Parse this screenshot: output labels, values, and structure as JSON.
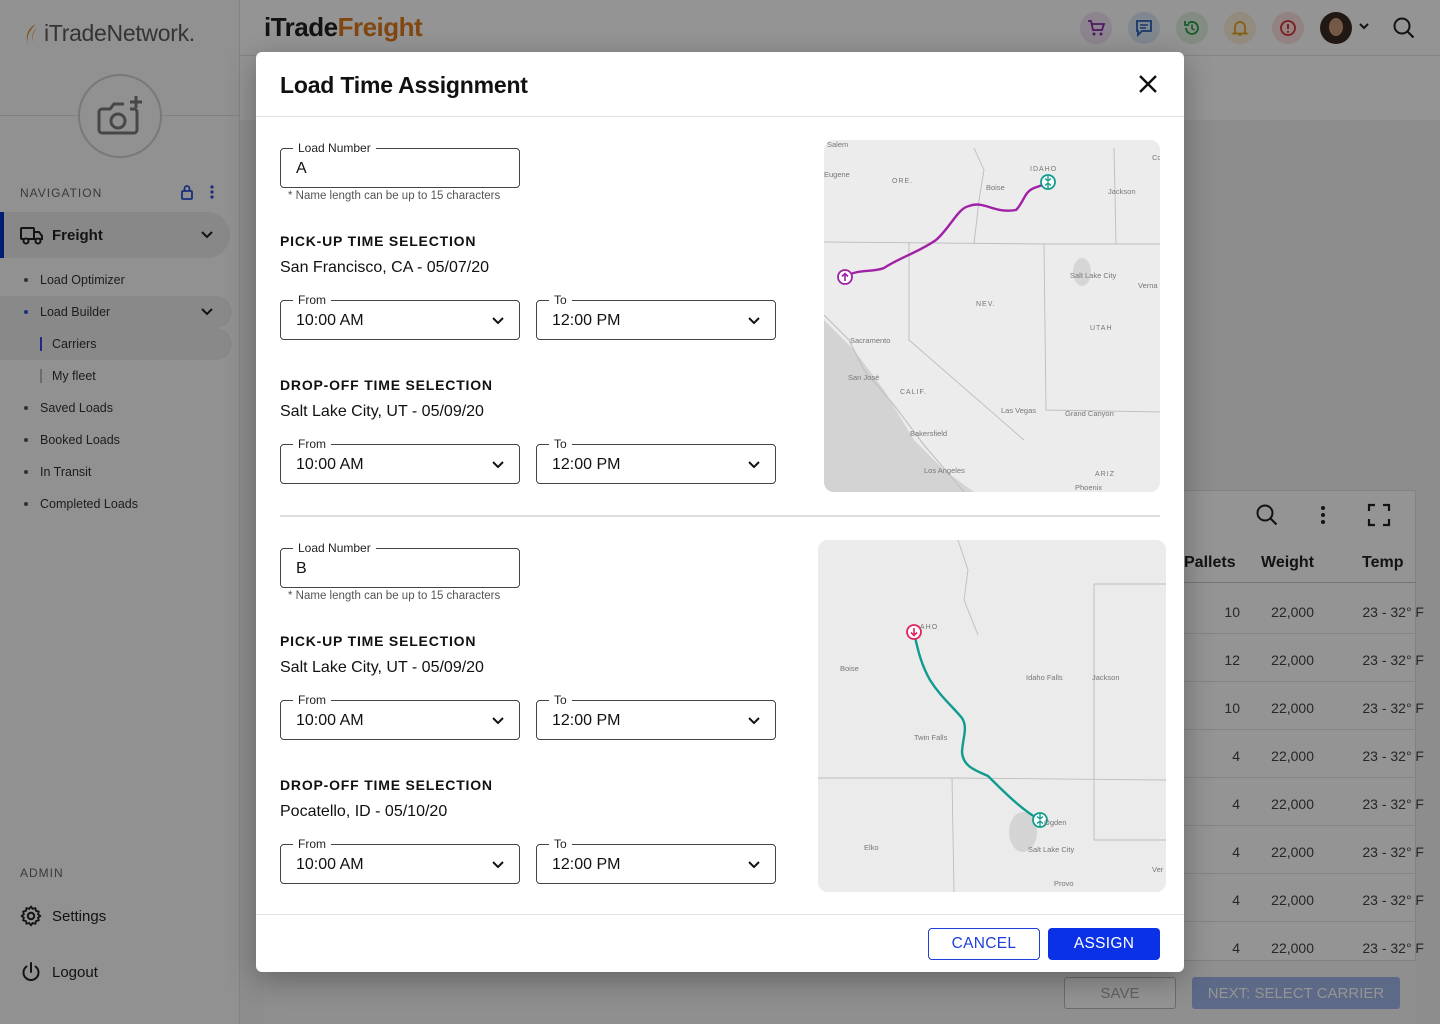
{
  "sidebar": {
    "brand": "iTradeNetwork.",
    "navigation_title": "NAVIGATION",
    "freight_label": "Freight",
    "items": [
      {
        "label": "Load Optimizer"
      },
      {
        "label": "Load Builder"
      },
      {
        "label": "Carriers"
      },
      {
        "label": "My fleet"
      },
      {
        "label": "Saved Loads"
      },
      {
        "label": "Booked Loads"
      },
      {
        "label": "In Transit"
      },
      {
        "label": "Completed Loads"
      }
    ],
    "admin_title": "ADMIN",
    "settings_label": "Settings",
    "logout_label": "Logout"
  },
  "header": {
    "logo_part1": "iTrade",
    "logo_part2": "Freight",
    "icons": [
      "cart-icon",
      "chat-icon",
      "history-icon",
      "bell-icon",
      "alert-icon",
      "avatar",
      "chevron-down-icon",
      "search-icon"
    ]
  },
  "table": {
    "columns": [
      "Pallets",
      "Weight",
      "Temp"
    ],
    "rows": [
      {
        "pallets": "10",
        "weight": "22,000",
        "temp": "23 - 32° F"
      },
      {
        "pallets": "12",
        "weight": "22,000",
        "temp": "23 - 32° F"
      },
      {
        "pallets": "10",
        "weight": "22,000",
        "temp": "23 - 32° F"
      },
      {
        "pallets": "4",
        "weight": "22,000",
        "temp": "23 - 32° F"
      },
      {
        "pallets": "4",
        "weight": "22,000",
        "temp": "23 - 32° F"
      },
      {
        "pallets": "4",
        "weight": "22,000",
        "temp": "23 - 32° F"
      },
      {
        "pallets": "4",
        "weight": "22,000",
        "temp": "23 - 32° F"
      },
      {
        "pallets": "4",
        "weight": "22,000",
        "temp": "23 - 32° F"
      }
    ],
    "save_label": "SAVE",
    "next_label": "NEXT: SELECT CARRIER"
  },
  "modal": {
    "title": "Load Time Assignment",
    "cancel_label": "CANCEL",
    "assign_label": "ASSIGN",
    "loads": [
      {
        "load_number_label": "Load Number",
        "load_number": "A",
        "hint": "* Name length can be up to 15 characters",
        "pickup_title": "PICK-UP TIME SELECTION",
        "pickup_location": "San Francisco, CA - 05/07/20",
        "pickup_from_label": "From",
        "pickup_from": "10:00 AM",
        "pickup_to_label": "To",
        "pickup_to": "12:00 PM",
        "dropoff_title": "DROP-OFF TIME SELECTION",
        "dropoff_location": "Salt Lake City, UT - 05/09/20",
        "dropoff_from_label": "From",
        "dropoff_from": "10:00 AM",
        "dropoff_to_label": "To",
        "dropoff_to": "12:00 PM",
        "map_labels": [
          "Salem",
          "IDAHO",
          "Eugene",
          "ORE.",
          "Boise",
          "Jackson",
          "Salt Lake City",
          "Verna",
          "NEV.",
          "UTAH",
          "Sacramento",
          "San José",
          "CALIF.",
          "Las Vegas",
          "Grand Canyon",
          "Bakersfield",
          "Los Angeles",
          "ARIZ",
          "Phoenix",
          "Co"
        ],
        "route_color": "#a020a8"
      },
      {
        "load_number_label": "Load Number",
        "load_number": "B",
        "hint": "* Name length can be up to 15 characters",
        "pickup_title": "PICK-UP TIME SELECTION",
        "pickup_location": "Salt Lake City, UT - 05/09/20",
        "pickup_from_label": "From",
        "pickup_from": "10:00 AM",
        "pickup_to_label": "To",
        "pickup_to": "12:00 PM",
        "dropoff_title": "DROP-OFF TIME SELECTION",
        "dropoff_location": "Pocatello, ID - 05/10/20",
        "dropoff_from_label": "From",
        "dropoff_from": "10:00 AM",
        "dropoff_to_label": "To",
        "dropoff_to": "12:00 PM",
        "map_labels": [
          "AHO",
          "Boise",
          "Idaho Falls",
          "Jackson",
          "Twin Falls",
          "Ogden",
          "Salt Lake City",
          "Elko",
          "Provo",
          "Ver"
        ],
        "route_color": "#0f9b8e"
      }
    ]
  },
  "colors": {
    "primary": "#0a31e6",
    "brand_orange": "#e07b1c",
    "route_a": "#a020a8",
    "route_b": "#0f9b8e",
    "marker_dropoff": "#e0245e"
  }
}
